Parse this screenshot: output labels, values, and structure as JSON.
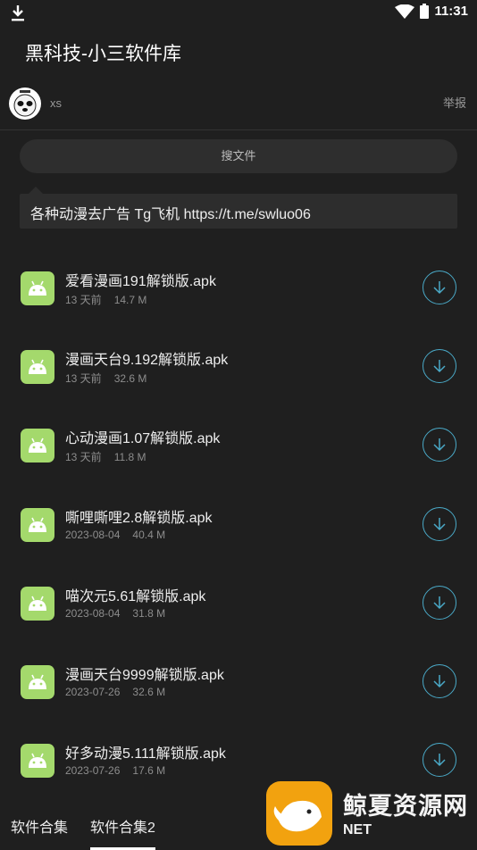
{
  "status": {
    "time": "11:31"
  },
  "app": {
    "title": "黑科技-小三软件库"
  },
  "owner": {
    "name": "xs",
    "report_label": "举报"
  },
  "search": {
    "label": "搜文件"
  },
  "notice": {
    "text": "各种动漫去广告 Tg飞机 https://t.me/swluo06"
  },
  "files": [
    {
      "name": "爱看漫画191解锁版.apk",
      "date": "13 天前",
      "size": "14.7 M"
    },
    {
      "name": "漫画天台9.192解锁版.apk",
      "date": "13 天前",
      "size": "32.6 M"
    },
    {
      "name": "心动漫画1.07解锁版.apk",
      "date": "13 天前",
      "size": "11.8 M"
    },
    {
      "name": "嘶哩嘶哩2.8解锁版.apk",
      "date": "2023-08-04",
      "size": "40.4 M"
    },
    {
      "name": "喵次元5.61解锁版.apk",
      "date": "2023-08-04",
      "size": "31.8 M"
    },
    {
      "name": "漫画天台9999解锁版.apk",
      "date": "2023-07-26",
      "size": "32.6 M"
    },
    {
      "name": "好多动漫5.111解锁版.apk",
      "date": "2023-07-26",
      "size": "17.6 M"
    }
  ],
  "tabs": [
    {
      "label": "软件合集"
    },
    {
      "label": "软件合集2"
    }
  ],
  "watermark": {
    "text": "鲸夏资源网",
    "sub": "NET"
  },
  "colors": {
    "background": "#1f1f1f",
    "accent": "#4aa9c7",
    "app_icon": "#a4d96c"
  }
}
